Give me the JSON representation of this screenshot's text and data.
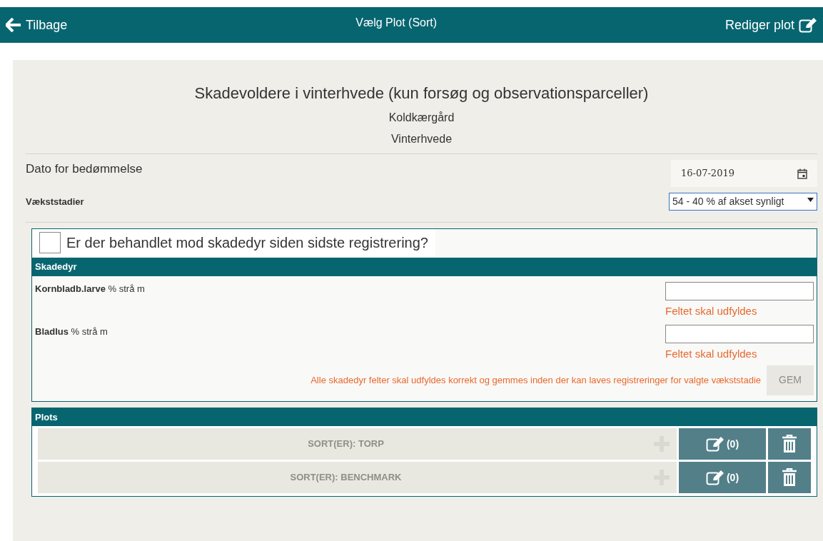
{
  "header": {
    "back": "Tilbage",
    "title": "Vælg Plot (Sort)",
    "edit": "Rediger plot"
  },
  "heading": {
    "title": "Skadevoldere i vinterhvede (kun forsøg og observationsparceller)",
    "farm": "Koldkærgård",
    "crop": "Vinterhvede"
  },
  "date": {
    "label": "Dato for bedømmelse",
    "value": "16-07-2019"
  },
  "stage": {
    "label": "Vækststadier",
    "value": "54 - 40 % af akset synligt"
  },
  "treated": {
    "label": "Er der behandlet mod skadedyr siden sidste registrering?",
    "checked": false
  },
  "pests": {
    "title": "Skadedyr",
    "fields": [
      {
        "name": "Kornbladb.larve",
        "unit": "% strå m",
        "error": "Feltet skal udfyldes"
      },
      {
        "name": "Bladlus",
        "unit": "% strå m",
        "error": "Feltet skal udfyldes"
      }
    ],
    "warning": "Alle skadedyr felter skal udfyldes korrekt og gemmes inden der kan laves registreringer for valgte vækststadie",
    "save": {
      "label": "GEM",
      "disabled": true
    }
  },
  "plots": {
    "title": "Plots",
    "rows": [
      {
        "label": "SORT(ER): TORP",
        "count": "(0)",
        "disabled": true
      },
      {
        "label": "SORT(ER): BENCHMARK",
        "count": "(0)",
        "disabled": true
      }
    ]
  }
}
